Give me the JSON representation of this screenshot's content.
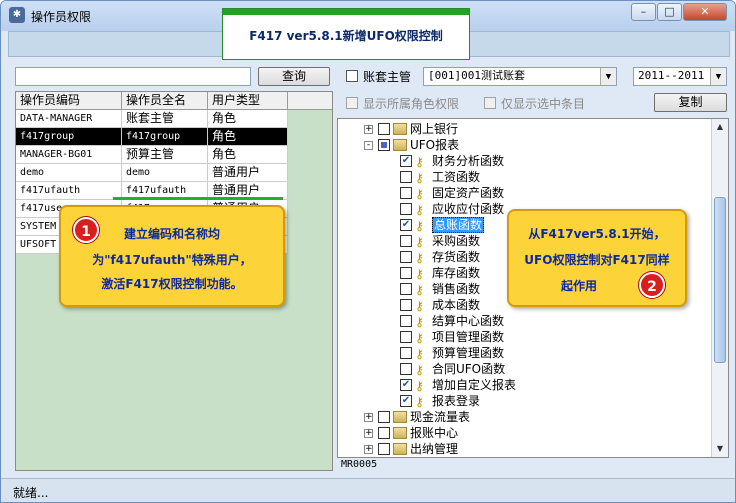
{
  "window": {
    "title": "操作员权限",
    "buttons": [
      "–",
      "□",
      "✕"
    ]
  },
  "banner": "F417 ver5.8.1新增UFO权限控制",
  "search": {
    "value": "",
    "button_label": "查询"
  },
  "filters": {
    "account_master_label": "账套主管",
    "account_value": "[001]001测试账套",
    "year_value": "2011--2011",
    "show_role_label": "显示所属角色权限",
    "show_selected_label": "仅显示选中条目",
    "copy_button": "复制"
  },
  "grid": {
    "headers": [
      "操作员编码",
      "操作员全名",
      "用户类型"
    ],
    "rows": [
      [
        "DATA-MANAGER",
        "账套主管",
        "角色"
      ],
      [
        "f417group",
        "f417group",
        "角色"
      ],
      [
        "MANAGER-BG01",
        "预算主管",
        "角色"
      ],
      [
        "demo",
        "demo",
        "普通用户"
      ],
      [
        "f417ufauth",
        "f417ufauth",
        "普通用户"
      ],
      [
        "f417user",
        "f417user",
        "普通用户"
      ],
      [
        "SYSTEM",
        "",
        ""
      ],
      [
        "UFSOFT",
        "",
        ""
      ]
    ],
    "selected_index": 1
  },
  "tree": {
    "nodes": [
      {
        "label": "网上银行",
        "level": 0,
        "toggle": "+",
        "check": "none",
        "icon": "folder"
      },
      {
        "label": "UFO报表",
        "level": 0,
        "toggle": "-",
        "check": "partial",
        "icon": "folder"
      },
      {
        "label": "财务分析函数",
        "level": 1,
        "check": "checked",
        "icon": "key"
      },
      {
        "label": "工资函数",
        "level": 1,
        "check": "none",
        "icon": "key"
      },
      {
        "label": "固定资产函数",
        "level": 1,
        "check": "none",
        "icon": "key"
      },
      {
        "label": "应收应付函数",
        "level": 1,
        "check": "none",
        "icon": "key"
      },
      {
        "label": "总账函数",
        "level": 1,
        "check": "checked",
        "icon": "key",
        "highlight": true
      },
      {
        "label": "采购函数",
        "level": 1,
        "check": "none",
        "icon": "key"
      },
      {
        "label": "存货函数",
        "level": 1,
        "check": "none",
        "icon": "key"
      },
      {
        "label": "库存函数",
        "level": 1,
        "check": "none",
        "icon": "key"
      },
      {
        "label": "销售函数",
        "level": 1,
        "check": "none",
        "icon": "key"
      },
      {
        "label": "成本函数",
        "level": 1,
        "check": "none",
        "icon": "key"
      },
      {
        "label": "结算中心函数",
        "level": 1,
        "check": "none",
        "icon": "key"
      },
      {
        "label": "项目管理函数",
        "level": 1,
        "check": "none",
        "icon": "key"
      },
      {
        "label": "预算管理函数",
        "level": 1,
        "check": "none",
        "icon": "key"
      },
      {
        "label": "合同UFO函数",
        "level": 1,
        "check": "none",
        "icon": "key"
      },
      {
        "label": "增加自定义报表",
        "level": 1,
        "check": "checked",
        "icon": "key"
      },
      {
        "label": "报表登录",
        "level": 1,
        "check": "checked",
        "icon": "key"
      },
      {
        "label": "现金流量表",
        "level": 0,
        "toggle": "+",
        "check": "none",
        "icon": "folder"
      },
      {
        "label": "报账中心",
        "level": 0,
        "toggle": "+",
        "check": "none",
        "icon": "folder"
      },
      {
        "label": "出纳管理",
        "level": 0,
        "toggle": "+",
        "check": "none",
        "icon": "folder"
      }
    ],
    "status_code": "MR0005"
  },
  "callouts": {
    "one": {
      "badge": "1",
      "lines": [
        "建立编码和名称均",
        "为\"f417ufauth\"特殊用户，",
        "激活F417权限控制功能。"
      ]
    },
    "two": {
      "badge": "2",
      "lines": [
        "从F417ver5.8.1开始，",
        "UFO权限控制对F417同样",
        "起作用"
      ]
    }
  },
  "statusbar": "就绪..."
}
